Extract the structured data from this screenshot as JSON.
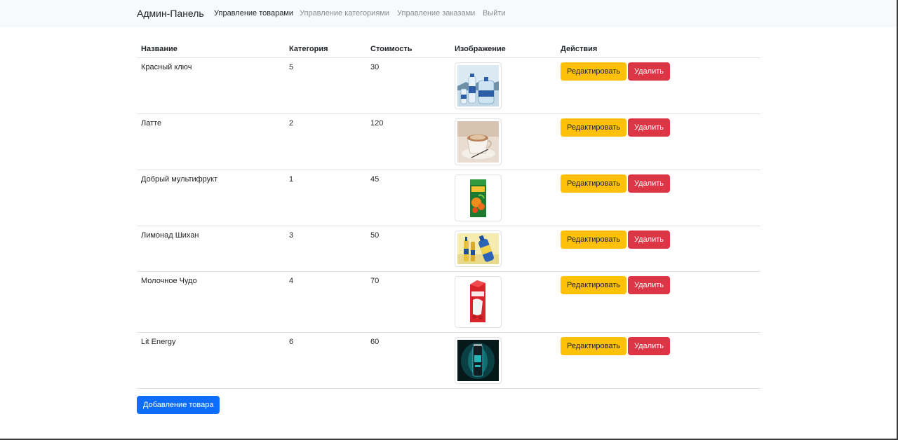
{
  "navbar": {
    "brand": "Админ-Панель",
    "links": [
      {
        "label": "Управление товарами",
        "active": true
      },
      {
        "label": "Управление категориями",
        "active": false
      },
      {
        "label": "Управление заказами",
        "active": false
      },
      {
        "label": "Выйти",
        "active": false
      }
    ]
  },
  "table": {
    "headers": [
      "Название",
      "Категория",
      "Стоимость",
      "Изображение",
      "Действия"
    ],
    "rows": [
      {
        "name": "Красный ключ",
        "category": "5",
        "price": "30",
        "image": "water-bottles-image",
        "edit_label": "Редактировать",
        "delete_label": "Удалить"
      },
      {
        "name": "Латте",
        "category": "2",
        "price": "120",
        "image": "latte-cup-image",
        "edit_label": "Редактировать",
        "delete_label": "Удалить"
      },
      {
        "name": "Добрый мультифрукт",
        "category": "1",
        "price": "45",
        "image": "juice-carton-image",
        "edit_label": "Редактировать",
        "delete_label": "Удалить"
      },
      {
        "name": "Лимонад Шихан",
        "category": "3",
        "price": "50",
        "image": "lemonade-bottles-image",
        "edit_label": "Редактировать",
        "delete_label": "Удалить"
      },
      {
        "name": "Молочное Чудо",
        "category": "4",
        "price": "70",
        "image": "milk-carton-image",
        "edit_label": "Редактировать",
        "delete_label": "Удалить"
      },
      {
        "name": "Lit Energy",
        "category": "6",
        "price": "60",
        "image": "energy-can-image",
        "edit_label": "Редактировать",
        "delete_label": "Удалить"
      }
    ]
  },
  "add_button_label": "Добавление товара",
  "colors": {
    "edit_button": "#ffc107",
    "delete_button": "#dc3545",
    "add_button": "#0d6efd",
    "navbar_bg": "#f8f9fa"
  }
}
